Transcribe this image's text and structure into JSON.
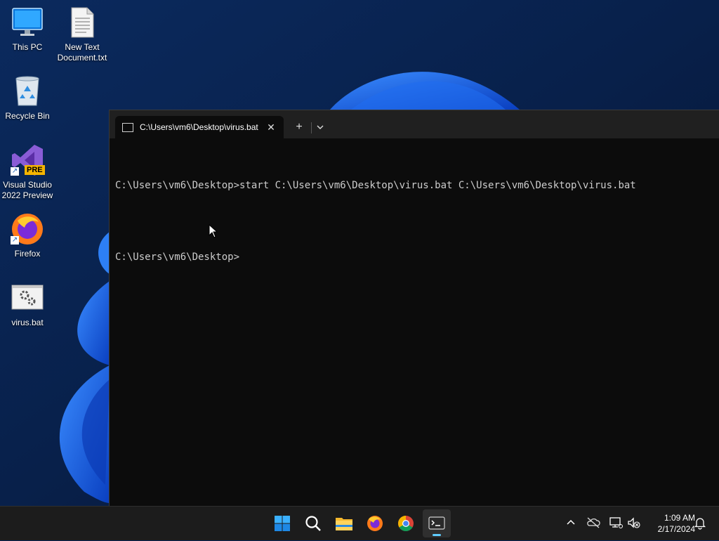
{
  "desktop": {
    "icons": [
      {
        "label": "This PC",
        "icon": "monitor-icon"
      },
      {
        "label": "New Text Document.txt",
        "icon": "text-file-icon"
      },
      {
        "label": "Recycle Bin",
        "icon": "recycle-bin-icon"
      },
      {
        "label": "Visual Studio 2022 Preview",
        "icon": "visual-studio-icon",
        "badge": "PRE"
      },
      {
        "label": "Firefox",
        "icon": "firefox-icon"
      },
      {
        "label": "virus.bat",
        "icon": "batch-file-icon"
      }
    ]
  },
  "terminal": {
    "tab_title": "C:\\Users\\vm6\\Desktop\\virus.bat",
    "tab_close_glyph": "✕",
    "new_tab_glyph": "+",
    "lines": [
      "C:\\Users\\vm6\\Desktop>start C:\\Users\\vm6\\Desktop\\virus.bat C:\\Users\\vm6\\Desktop\\virus.bat",
      "",
      "C:\\Users\\vm6\\Desktop>"
    ]
  },
  "taskbar": {
    "apps": [
      {
        "name": "start-button",
        "icon": "windows-logo-icon"
      },
      {
        "name": "search-button",
        "icon": "search-icon"
      },
      {
        "name": "file-explorer-button",
        "icon": "folder-icon"
      },
      {
        "name": "firefox-taskbar-button",
        "icon": "firefox-icon"
      },
      {
        "name": "chrome-taskbar-button",
        "icon": "chrome-icon"
      },
      {
        "name": "terminal-taskbar-button",
        "icon": "terminal-icon",
        "active": true
      }
    ],
    "tray": [
      "chevron-up-icon",
      "cloud-off-icon",
      "network-icon",
      "volume-muted-icon"
    ],
    "time": "1:09 AM",
    "date": "2/17/2024"
  },
  "colors": {
    "accent": "#60cdff",
    "terminal_bg": "#0c0c0c",
    "terminal_text": "#cccccc",
    "taskbar_bg": "#1c1c1c"
  }
}
